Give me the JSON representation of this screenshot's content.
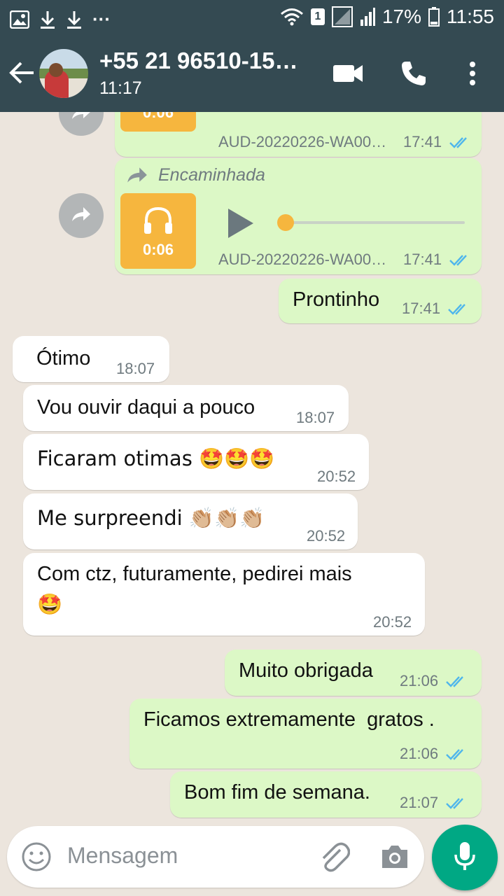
{
  "status_bar": {
    "battery": "17%",
    "time": "11:55",
    "sim": "1",
    "overflow": "···"
  },
  "header": {
    "contact_name": "+55 21 96510-15…",
    "subtitle": "11:17"
  },
  "messages": [
    {
      "type": "audio",
      "dir": "out",
      "duration": "0:06",
      "filename": "AUD-20220226-WA00…",
      "time": "17:41"
    },
    {
      "type": "audio",
      "dir": "out",
      "forwarded_label": "Encaminhada",
      "duration": "0:06",
      "filename": "AUD-20220226-WA00…",
      "time": "17:41"
    },
    {
      "type": "text",
      "dir": "out",
      "text": "Prontinho",
      "time": "17:41"
    },
    {
      "type": "text",
      "dir": "in",
      "text": "Ótimo",
      "time": "18:07"
    },
    {
      "type": "text",
      "dir": "in",
      "text": "Vou ouvir daqui a pouco",
      "time": "18:07"
    },
    {
      "type": "text",
      "dir": "in",
      "text": "Ficaram otimas 🤩🤩🤩",
      "time": "20:52"
    },
    {
      "type": "text",
      "dir": "in",
      "text": "Me surpreendi 👏🏼👏🏼👏🏼",
      "time": "20:52"
    },
    {
      "type": "text",
      "dir": "in",
      "text_line1": "Com ctz, futuramente, pedirei mais",
      "text_line2": "🤩",
      "time": "20:52"
    },
    {
      "type": "text",
      "dir": "out",
      "text": "Muito obrigada",
      "time": "21:06"
    },
    {
      "type": "text",
      "dir": "out",
      "text": "Ficamos extremamente  gratos .",
      "time": "21:06"
    },
    {
      "type": "text",
      "dir": "out",
      "text": "Bom fim de semana.",
      "time": "21:07"
    }
  ],
  "input": {
    "placeholder": "Mensagem"
  },
  "colors": {
    "header": "#344a52",
    "outgoing": "#dcf8c6",
    "incoming": "#ffffff",
    "read_ticks": "#4fb6ec",
    "mic": "#00a884",
    "audio_thumb": "#f6b63e"
  }
}
